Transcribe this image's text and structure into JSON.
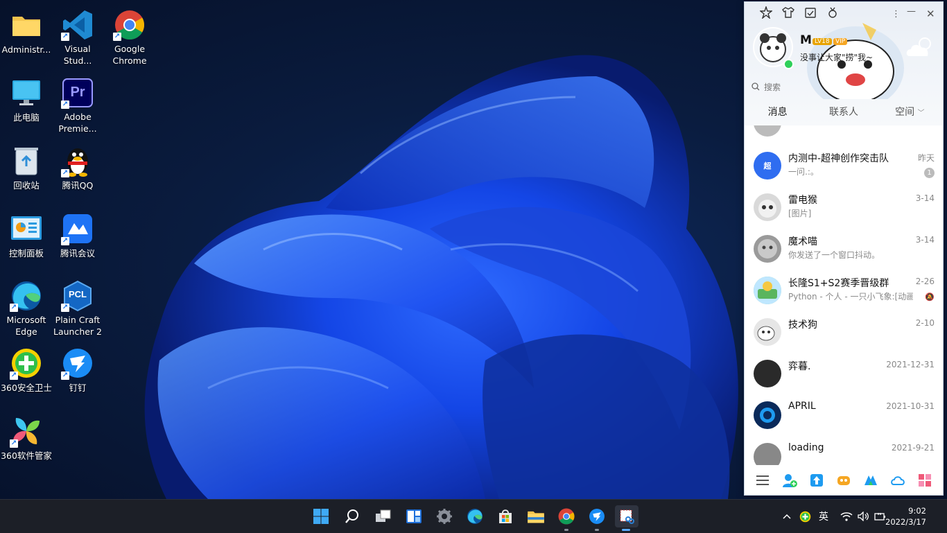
{
  "desktop": {
    "icons": [
      {
        "label": "Administr...",
        "icon": "folder-icon"
      },
      {
        "label": "Visual\nStud...",
        "icon": "vscode-icon"
      },
      {
        "label": "Google\nChrome",
        "icon": "chrome-icon"
      },
      {
        "label": "此电脑",
        "icon": "this-pc-icon"
      },
      {
        "label": "Adobe\nPremie...",
        "icon": "premiere-icon"
      },
      {
        "label": "回收站",
        "icon": "recycle-bin-icon"
      },
      {
        "label": "腾讯QQ",
        "icon": "qq-penguin-icon"
      },
      {
        "label": "控制面板",
        "icon": "control-panel-icon"
      },
      {
        "label": "腾讯会议",
        "icon": "tencent-meeting-icon"
      },
      {
        "label": "Microsoft\nEdge",
        "icon": "edge-icon"
      },
      {
        "label": "Plain Craft\nLauncher 2",
        "icon": "pcl-icon"
      },
      {
        "label": "360安全卫士",
        "icon": "360-safe-icon"
      },
      {
        "label": "钉钉",
        "icon": "dingtalk-icon"
      },
      {
        "label": "360软件管家",
        "icon": "360-software-icon"
      }
    ],
    "pcl_text": "PCL",
    "pr_text": "Pr"
  },
  "qq": {
    "nickname": "M",
    "level_badge": "LV18",
    "vip_badge": "VIP",
    "signature": "没事让大家\"捞\"我~",
    "search_placeholder": "搜索",
    "tabs": [
      {
        "label": "消息"
      },
      {
        "label": "联系人"
      },
      {
        "label": "空间"
      }
    ],
    "conversations": [
      {
        "name": "内测中-超神创作突击队",
        "preview": "一问.:。",
        "time": "昨天",
        "badge": "1",
        "avatar_text": "超",
        "avatar_color": "#2f6df0"
      },
      {
        "name": "雷电猴",
        "preview": "[图片]",
        "time": "3-14",
        "avatar_color": "#d9d9d9"
      },
      {
        "name": "魔术喵",
        "preview": "你发送了一个窗口抖动。",
        "time": "3-14",
        "avatar_color": "#9a9a9a"
      },
      {
        "name": "长隆S1+S2赛季晋级群",
        "preview": "Python - 个人 - 一只小飞象:[动画",
        "time": "2-26",
        "avatar_color": "#7ec8a8"
      },
      {
        "name": "技术狗",
        "preview": "",
        "time": "2-10",
        "avatar_color": "#e6e6e6"
      },
      {
        "name": "弈暮.",
        "preview": "",
        "time": "2021-12-31",
        "avatar_color": "#2a2a2a"
      },
      {
        "name": "APRIL",
        "preview": "",
        "time": "2021-10-31",
        "avatar_color": "#0b2a5a"
      },
      {
        "name": "loading",
        "preview": "",
        "time": "2021-9-21",
        "avatar_color": "#888888"
      }
    ],
    "accent_color": "#1e9bf0"
  },
  "taskbar": {
    "ime": "英",
    "time": "9:02",
    "date": "2022/3/17"
  }
}
